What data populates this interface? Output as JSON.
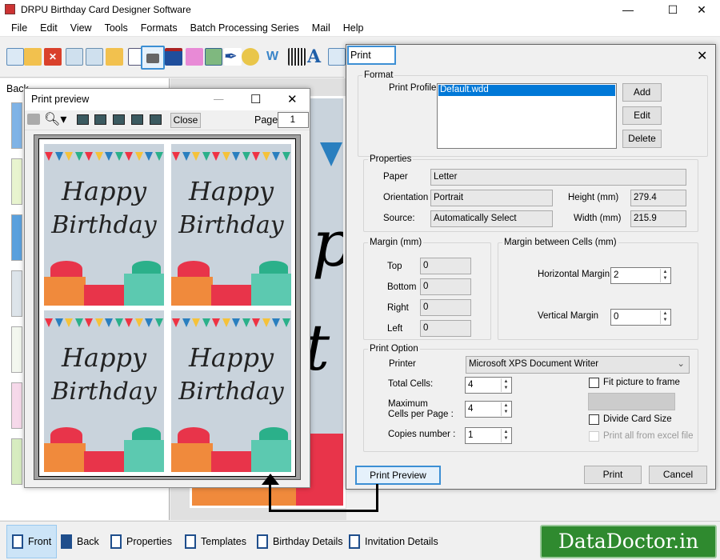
{
  "app": {
    "title": "DRPU Birthday Card Designer Software",
    "minimize": "—",
    "maximize": "☐",
    "close": "✕"
  },
  "menu": [
    "File",
    "Edit",
    "View",
    "Tools",
    "Formats",
    "Batch Processing Series",
    "Mail",
    "Help"
  ],
  "left_panel": {
    "tab_label": "Back"
  },
  "card": {
    "line1": "Happy",
    "line2": "Birthday",
    "canvas_letters": [
      "p",
      "t"
    ]
  },
  "preview": {
    "title": "Print preview",
    "close_label": "Close",
    "page_label": "Page",
    "page_value": "1",
    "minimize": "—",
    "maximize": "☐",
    "close": "✕"
  },
  "print": {
    "title": "Print",
    "close": "✕",
    "format": {
      "legend": "Format",
      "profile_label": "Print Profile",
      "profile_selected": "Default.wdd",
      "add": "Add",
      "edit": "Edit",
      "delete": "Delete"
    },
    "properties": {
      "legend": "Properties",
      "paper_label": "Paper",
      "paper": "Letter",
      "orientation_label": "Orientation",
      "orientation": "Portrait",
      "source_label": "Source:",
      "source": "Automatically Select",
      "height_label": "Height (mm)",
      "height": "279.4",
      "width_label": "Width (mm)",
      "width": "215.9"
    },
    "margin": {
      "legend": "Margin (mm)",
      "top_label": "Top",
      "top": "0",
      "bottom_label": "Bottom",
      "bottom": "0",
      "right_label": "Right",
      "right": "0",
      "left_label": "Left",
      "left": "0"
    },
    "cell_margin": {
      "legend": "Margin between Cells (mm)",
      "h_label": "Horizontal Margin",
      "h": "2",
      "v_label": "Vertical Margin",
      "v": "0"
    },
    "option": {
      "legend": "Print Option",
      "printer_label": "Printer",
      "printer": "Microsoft XPS Document Writer",
      "total_label": "Total Cells:",
      "total": "4",
      "max_label1": "Maximum",
      "max_label2": "Cells per Page :",
      "max": "4",
      "copies_label": "Copies number :",
      "copies": "1",
      "fit_label": "Fit picture to frame",
      "divide_label": "Divide Card Size",
      "excel_label": "Print all from excel file"
    },
    "preview_btn": "Print Preview",
    "print_btn": "Print",
    "cancel_btn": "Cancel"
  },
  "bottom_tabs": [
    "Front",
    "Back",
    "Properties",
    "Templates",
    "Birthday Details",
    "Invitation Details"
  ],
  "logo": "DataDoctor.in",
  "colors": {
    "accent": "#3c8fd4",
    "logo_bg": "#2f8a2f",
    "card_bg": "#c9d3dc"
  }
}
